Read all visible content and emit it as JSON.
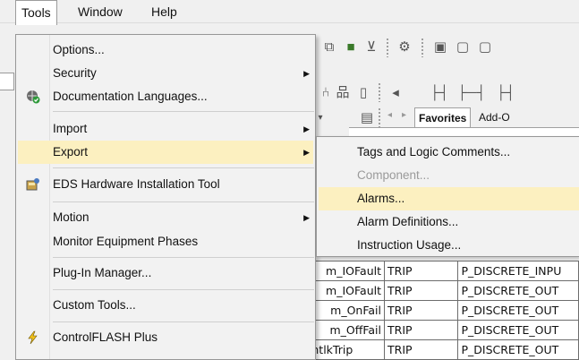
{
  "menubar": {
    "items": [
      "Tools",
      "Window",
      "Help"
    ]
  },
  "tools_menu": {
    "items": [
      {
        "label": "Options...",
        "icon": "",
        "submenu": false
      },
      {
        "label": "Security",
        "icon": "",
        "submenu": true
      },
      {
        "label": "Documentation Languages...",
        "icon": "globe-check-icon",
        "submenu": false
      },
      {
        "label": "Import",
        "icon": "",
        "submenu": true
      },
      {
        "label": "Export",
        "icon": "",
        "submenu": true,
        "highlighted": true
      },
      {
        "label": "EDS Hardware Installation Tool",
        "icon": "eds-tool-icon",
        "submenu": false
      },
      {
        "label": "Motion",
        "icon": "",
        "submenu": true
      },
      {
        "label": "Monitor Equipment Phases",
        "icon": "",
        "submenu": false
      },
      {
        "label": "Plug-In Manager...",
        "icon": "",
        "submenu": false
      },
      {
        "label": "Custom Tools...",
        "icon": "",
        "submenu": false
      },
      {
        "label": "ControlFLASH Plus",
        "icon": "controlflash-icon",
        "submenu": false
      }
    ]
  },
  "export_menu": {
    "items": [
      {
        "label": "Tags and Logic Comments...",
        "disabled": false
      },
      {
        "label": "Component...",
        "disabled": true
      },
      {
        "label": "Alarms...",
        "disabled": false,
        "highlighted": true
      },
      {
        "label": "Alarm Definitions...",
        "disabled": false
      },
      {
        "label": "Instruction Usage...",
        "disabled": false
      }
    ]
  },
  "tabs": {
    "favorites": "Favorites",
    "addon": "Add-O"
  },
  "grid": {
    "rows": [
      [
        "m_IOFault",
        "TRIP",
        "P_DISCRETE_INPU"
      ],
      [
        "m_IOFault",
        "TRIP",
        "P_DISCRETE_OUT"
      ],
      [
        "m_OnFail",
        "TRIP",
        "P_DISCRETE_OUT"
      ],
      [
        "m_OffFail",
        "TRIP",
        "P_DISCRETE_OUT"
      ],
      [
        "P_DISCRETE_OUTPUT | Alm_IntlkTrip",
        "TRIP",
        "P_DISCRETE_OUT"
      ]
    ]
  },
  "colors": {
    "highlight": "#fcf0c0",
    "menu_bg": "#f2f2f2",
    "disabled_text": "#9a9a9a"
  }
}
